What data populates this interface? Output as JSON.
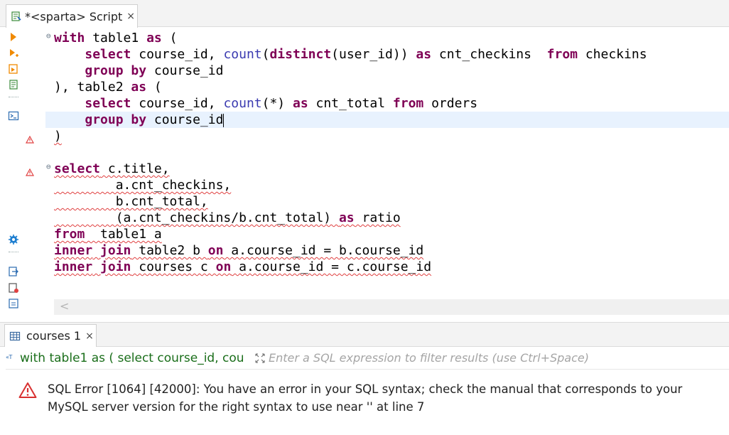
{
  "editor_tab": {
    "title": "*<sparta> Script",
    "close": "×"
  },
  "code": {
    "lines": [
      [
        "with table1 as ("
      ],
      [
        "select course_id, count(distinct(user_id)) as cnt_checkins  from checkins"
      ],
      [
        "group by course_id"
      ],
      [
        "), table2 as ("
      ],
      [
        "select course_id, count(*) as cnt_total from orders"
      ],
      [
        "group by course_id"
      ],
      [
        ")"
      ],
      [
        ""
      ],
      [
        "select c.title,"
      ],
      [
        "a.cnt_checkins,"
      ],
      [
        "b.cnt_total,"
      ],
      [
        "(a.cnt_checkins/b.cnt_total) as ratio"
      ],
      [
        "from  table1 a"
      ],
      [
        "inner join table2 b on a.course_id = b.course_id"
      ],
      [
        "inner join courses c on a.course_id = c.course_id"
      ]
    ]
  },
  "scroll": {
    "left_arrow": "<"
  },
  "results_tab": {
    "title": "courses 1",
    "close": "×"
  },
  "filter": {
    "query_preview": "with table1 as ( select course_id, cou",
    "placeholder": "Enter a SQL expression to filter results (use Ctrl+Space)"
  },
  "error": {
    "message": "SQL Error [1064] [42000]: You have an error in your SQL syntax; check the manual that corresponds to your MySQL server version for the right syntax to use near '' at line 7"
  },
  "icons": {
    "tab": "sql-script-icon",
    "results": "grid-table-icon",
    "error": "warning-triangle-icon"
  },
  "colors": {
    "keyword": "#7f0055",
    "current_line": "#e8f2fe",
    "error": "#e04040",
    "query_text": "#1a6e1a"
  }
}
